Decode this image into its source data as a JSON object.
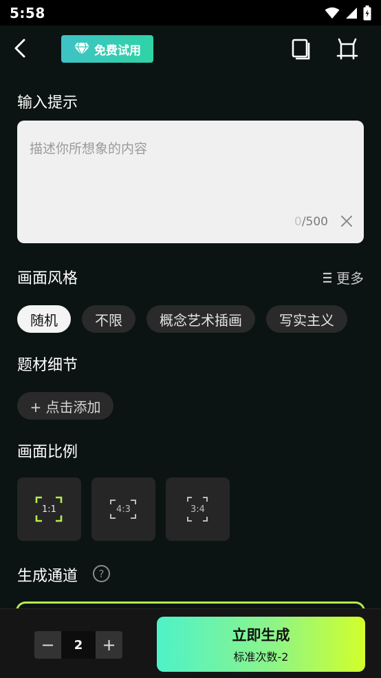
{
  "status_bar": {
    "time": "5:58"
  },
  "header": {
    "trial_label": "免费试用"
  },
  "prompt": {
    "title": "输入提示",
    "placeholder": "描述你所想象的内容",
    "count_current": "0",
    "count_max": "/500"
  },
  "style": {
    "title": "画面风格",
    "more_label": "更多",
    "chips": [
      {
        "label": "随机",
        "selected": true
      },
      {
        "label": "不限",
        "selected": false
      },
      {
        "label": "概念艺术插画",
        "selected": false
      },
      {
        "label": "写实主义",
        "selected": false
      }
    ]
  },
  "details": {
    "title": "题材细节",
    "add_label": "+ 点击添加"
  },
  "ratio": {
    "title": "画面比例",
    "options": [
      {
        "label": "1:1",
        "selected": true
      },
      {
        "label": "4:3",
        "selected": false
      },
      {
        "label": "3:4",
        "selected": false
      }
    ]
  },
  "channel": {
    "title": "生成通道",
    "help_glyph": "?"
  },
  "footer": {
    "quantity": "2",
    "minus_glyph": "−",
    "plus_glyph": "+",
    "generate_label": "立即生成",
    "generate_sub": "标准次数-2"
  },
  "colors": {
    "background": "#0b1412",
    "accent_green": "#b4f04a",
    "trial_badge": "#2fd3a5",
    "chip_bg": "#2a2a2a"
  }
}
